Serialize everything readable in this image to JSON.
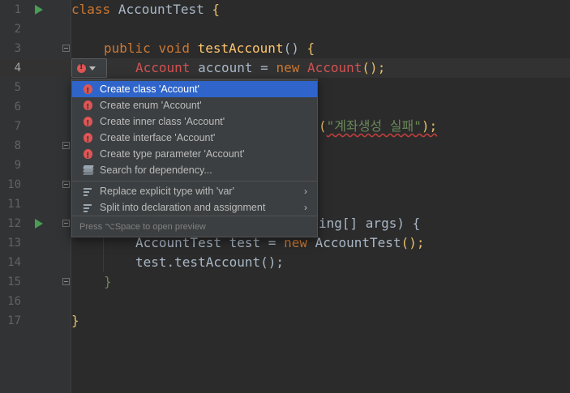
{
  "gutter": {
    "line_numbers": [
      "1",
      "2",
      "3",
      "4",
      "5",
      "6",
      "7",
      "8",
      "9",
      "10",
      "11",
      "12",
      "13",
      "14",
      "15",
      "16",
      "17"
    ],
    "active_line": 4
  },
  "code": {
    "l1_kw": "class",
    "l1_name": "AccountTest",
    "l1_brace": "{",
    "l3_public": "public",
    "l3_void": "void",
    "l3_fn": "testAccount",
    "l3_parens": "()",
    "l3_brace": "{",
    "l4_type": "Account",
    "l4_var": "account",
    "l4_eq": "=",
    "l4_new": "new",
    "l4_ctor": "Account",
    "l4_rest": "();",
    "l6_open": "(",
    "l6_str": "\"계좌생성 실패\"",
    "l6_close": ");",
    "l12_tail": "ing[] args) {",
    "l13_type": "AccountTest",
    "l13_var": "test",
    "l13_eq": "=",
    "l13_new": "new",
    "l13_ctor": "AccountTest",
    "l13_rest": "();",
    "l14": "test.testAccount();",
    "l15_brace": "}",
    "l17_brace": "}"
  },
  "popup": {
    "items": [
      {
        "label": "Create class 'Account'"
      },
      {
        "label": "Create enum 'Account'"
      },
      {
        "label": "Create inner class 'Account'"
      },
      {
        "label": "Create interface 'Account'"
      },
      {
        "label": "Create type parameter 'Account'"
      },
      {
        "label": "Search for dependency..."
      },
      {
        "label": "Replace explicit type with 'var'"
      },
      {
        "label": "Split into declaration and assignment"
      }
    ],
    "footer": "Press ⌥Space to open preview",
    "submenu_glyph": "›"
  },
  "colors": {
    "background": "#2b2b2b",
    "keyword": "#cc7832",
    "function": "#ffc66d",
    "error": "#d25252",
    "selection": "#2f65ca"
  },
  "icons": {
    "run": "run-gutter-icon",
    "error": "error-intention-icon",
    "search": "layers-icon",
    "intention": "edit-intention-icon"
  }
}
